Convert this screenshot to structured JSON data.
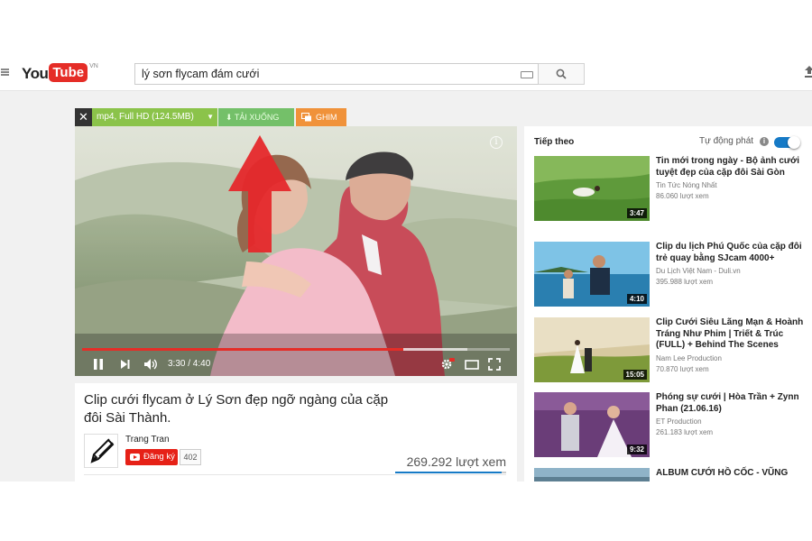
{
  "logo": {
    "you": "You",
    "tube": "Tube",
    "region": "VN"
  },
  "search": {
    "query": "lý sơn flycam đám cưới"
  },
  "download_bar": {
    "close": "✕",
    "format": "mp4, Full HD (124.5MB)",
    "download_label": "TẢI XUỐNG",
    "pin_label": "GHIM"
  },
  "player": {
    "time": "3:30 / 4:40",
    "progress": 0.75,
    "buffered": 0.9
  },
  "video": {
    "title": "Clip cưới flycam ở Lý Sơn đẹp ngỡ ngàng của cặp đôi Sài Thành.",
    "channel": "Trang Tran",
    "subscribe_label": "Đăng ký",
    "subscriber_count": "402",
    "views": "269.292 lượt xem",
    "like_ratio": 0.96
  },
  "sidebar": {
    "up_next": "Tiếp theo",
    "autoplay_label": "Tự động phát",
    "autoplay_on": true,
    "items": [
      {
        "title": "Tin mới trong ngày - Bộ ảnh cưới tuyệt đẹp của cặp đôi Sài Gòn",
        "channel": "Tin Tức Nóng Nhất",
        "views": "86.060 lượt xem",
        "duration": "3:47"
      },
      {
        "title": "Clip du lịch Phú Quốc của cặp đôi trẻ quay bằng SJcam 4000+",
        "channel": "Du Lịch Việt Nam - Duli.vn",
        "views": "395.988 lượt xem",
        "duration": "4:10"
      },
      {
        "title": "Clip Cưới Siêu Lãng Mạn & Hoành Tráng Như Phim | Triết & Trúc (FULL) + Behind The Scenes",
        "channel": "Nam Lee Production",
        "views": "70.870 lượt xem",
        "duration": "15:05"
      },
      {
        "title": "Phóng sự cưới | Hòa Trần + Zynn Phan (21.06.16)",
        "channel": "ET Production",
        "views": "261.183 lượt xem",
        "duration": "9:32"
      },
      {
        "title": "ALBUM CƯỚI HỒ CỐC - VŨNG",
        "channel": "",
        "views": "",
        "duration": ""
      }
    ]
  },
  "colors": {
    "youtube_red": "#e52d27",
    "download_green": "#74c069",
    "pin_orange": "#f0923a",
    "link_blue": "#167ac6"
  }
}
